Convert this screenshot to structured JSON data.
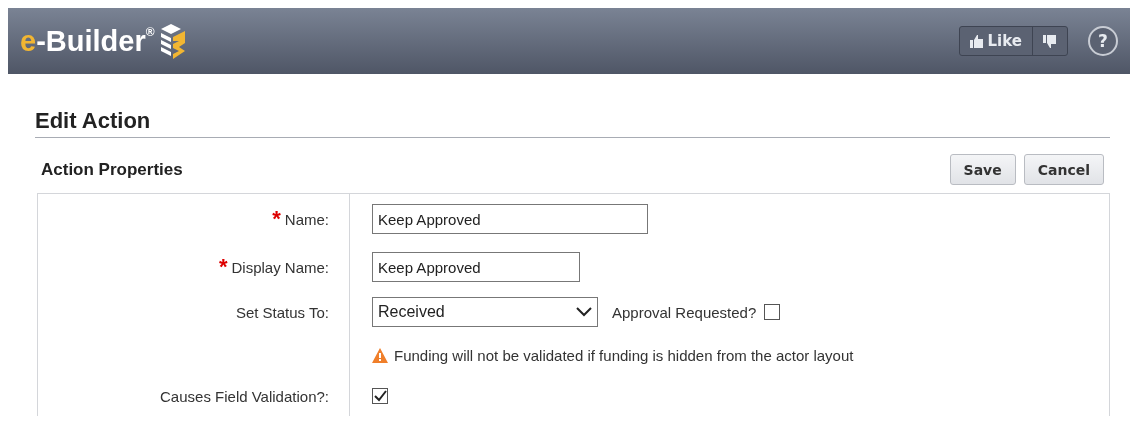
{
  "header": {
    "logo": {
      "prefix": "e",
      "name": "-Builder",
      "mark": "®"
    },
    "like": {
      "label": "Like"
    },
    "help": {
      "label": "?"
    }
  },
  "page": {
    "title": "Edit Action"
  },
  "section": {
    "title": "Action Properties",
    "buttons": [
      "Save",
      "Cancel"
    ]
  },
  "rows": [
    {
      "kind": "text",
      "marker": "*",
      "label": "Name:",
      "value": "Keep Approved"
    },
    {
      "kind": "text",
      "marker": "*",
      "label": "Display Name:",
      "value": "Keep Approved"
    },
    {
      "kind": "select",
      "label": "Set Status To:",
      "value": "Received",
      "extra_label": "Approval Requested?",
      "extra_checked": false
    },
    {
      "kind": "note",
      "text": "Funding will not be validated if funding is hidden from the actor layout"
    },
    {
      "kind": "checkbox",
      "label": "Causes Field Validation?:",
      "checked": true
    }
  ]
}
